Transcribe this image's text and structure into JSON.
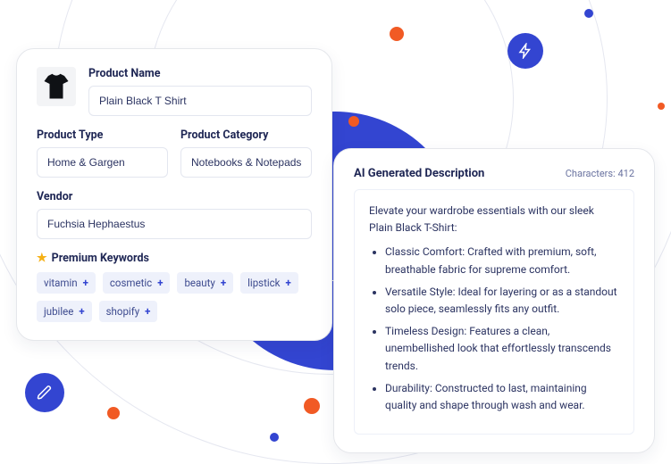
{
  "form": {
    "name_label": "Product Name",
    "name_value": "Plain Black T Shirt",
    "type_label": "Product Type",
    "type_value": "Home & Gargen",
    "category_label": "Product Category",
    "category_value": "Notebooks & Notepads",
    "vendor_label": "Vendor",
    "vendor_value": "Fuchsia Hephaestus",
    "keywords_label": "Premium Keywords",
    "keywords": [
      "vitamin",
      "cosmetic",
      "beauty",
      "lipstick",
      "jubilee",
      "shopify"
    ]
  },
  "desc": {
    "title": "AI Generated Description",
    "char_label": "Characters: 412",
    "intro": "Elevate your wardrobe essentials with our sleek Plain Black T-Shirt:",
    "bullets": [
      "Classic Comfort: Crafted with premium, soft, breathable fabric for supreme comfort.",
      "Versatile Style: Ideal for layering or as a standout solo piece, seamlessly fits any outfit.",
      "Timeless Design: Features a clean, unembellished look that effortlessly transcends trends.",
      "Durability: Constructed to last, maintaining quality and shape through wash and wear."
    ]
  },
  "colors": {
    "blue": "#3345d1",
    "orange": "#f15a24"
  }
}
